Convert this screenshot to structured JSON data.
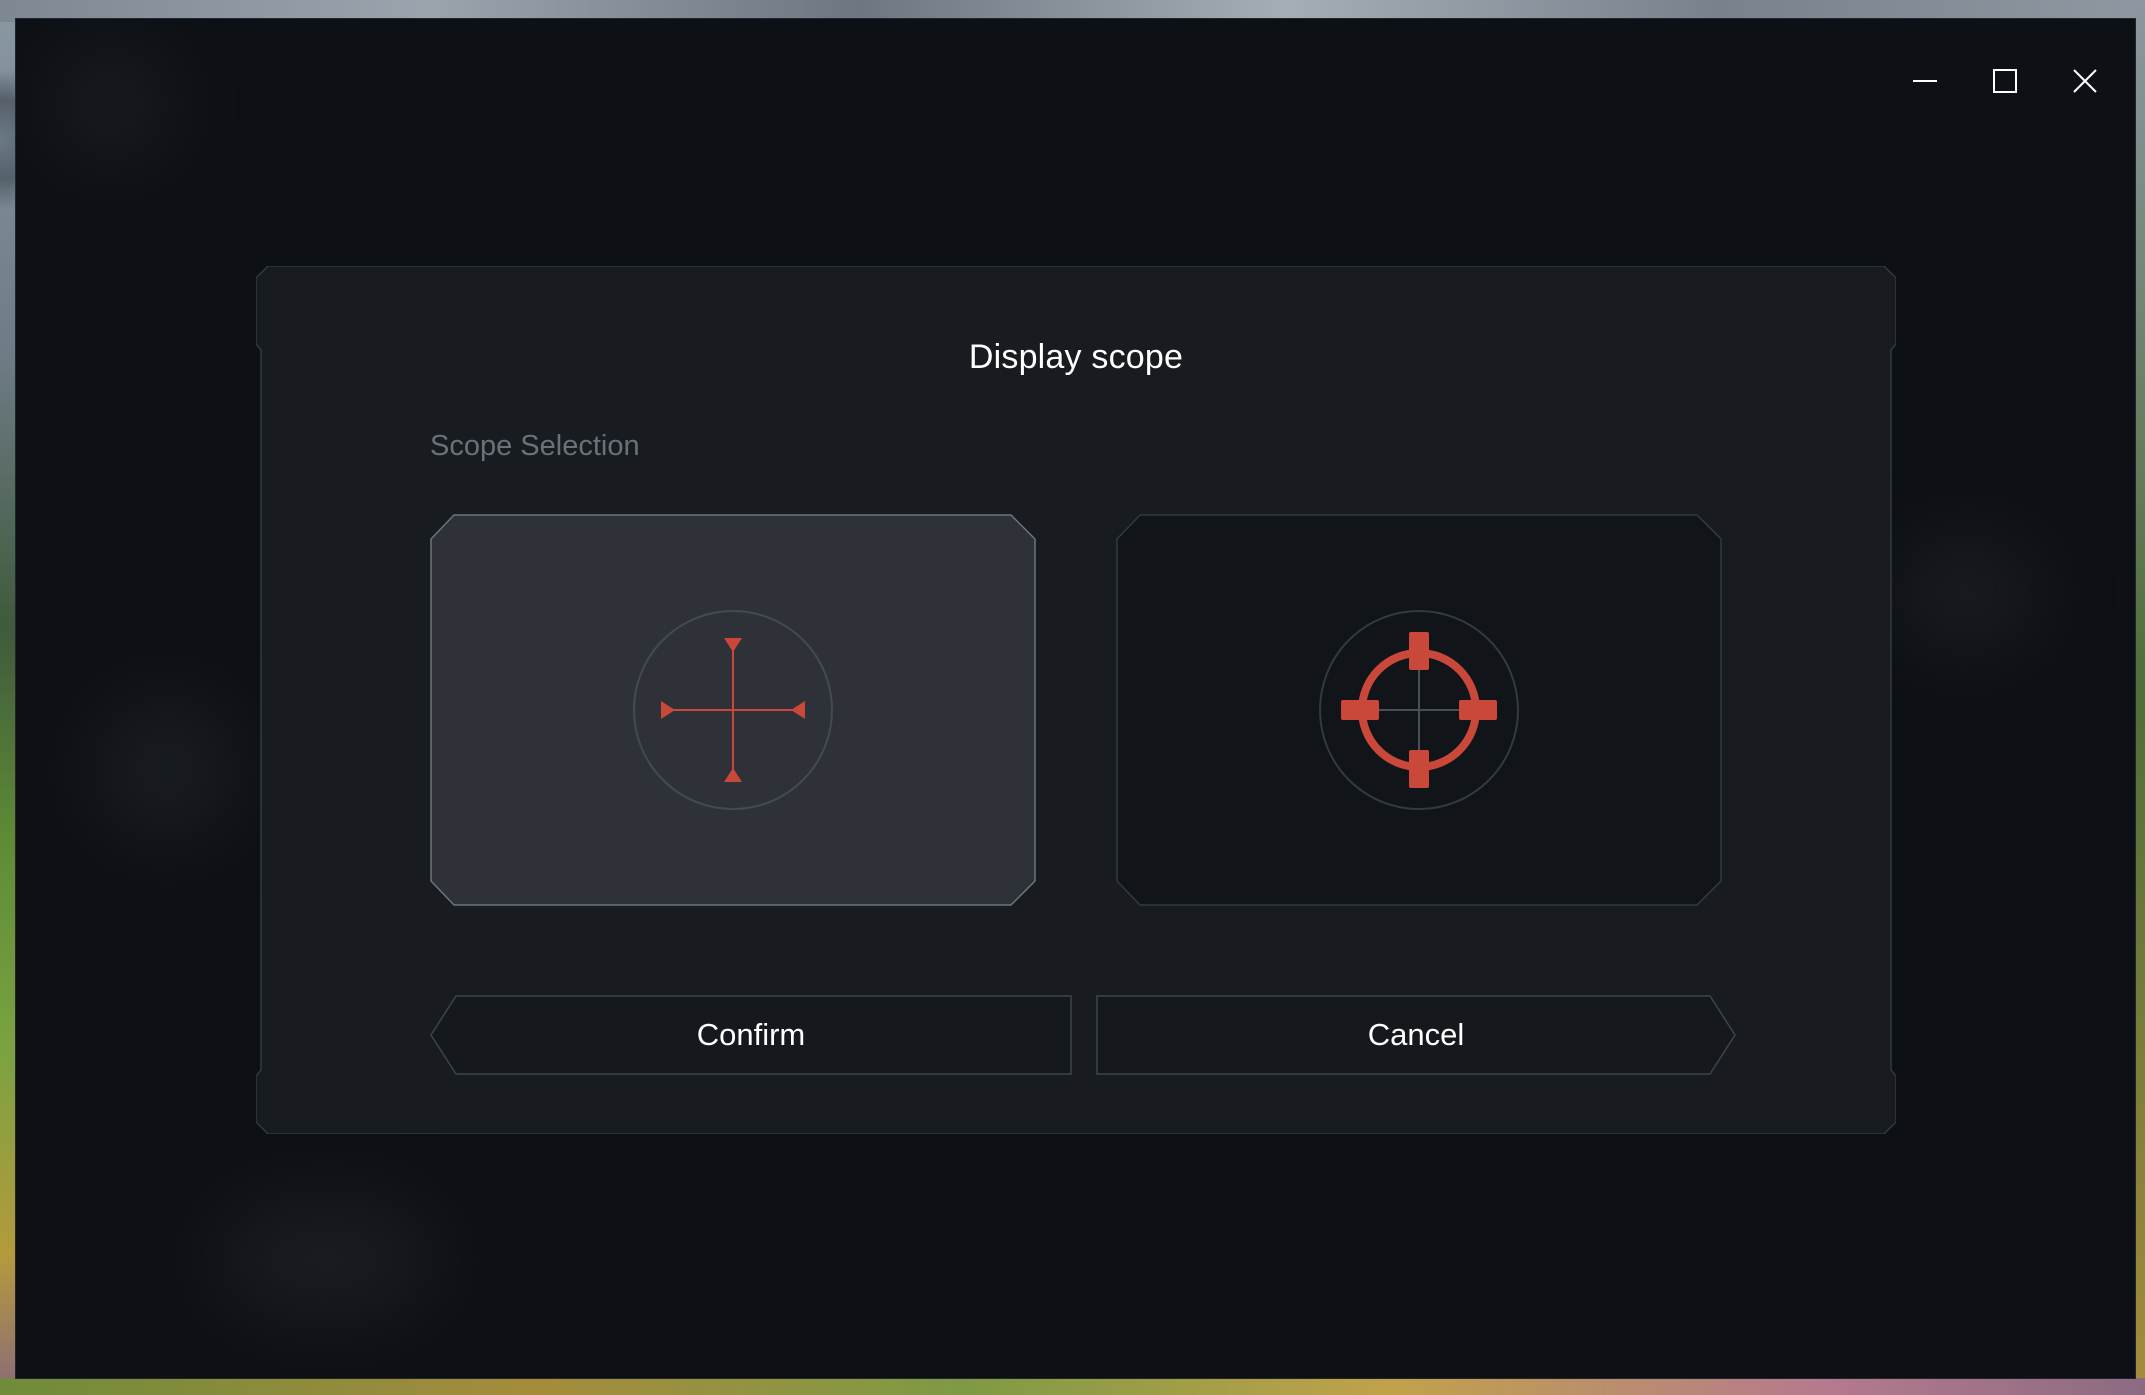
{
  "window": {
    "controls": {
      "minimize_icon": "minimize-icon",
      "maximize_icon": "maximize-icon",
      "close_icon": "close-icon"
    }
  },
  "dialog": {
    "title": "Display scope",
    "section_label": "Scope Selection",
    "options": [
      {
        "icon": "crosshair-arrows-icon",
        "selected": true
      },
      {
        "icon": "crosshair-target-icon",
        "selected": false
      }
    ],
    "buttons": {
      "confirm": "Confirm",
      "cancel": "Cancel"
    }
  },
  "colors": {
    "window_bg": "#0d1014",
    "dialog_bg": "#181b20",
    "dialog_border": "#343942",
    "option_selected_bg": "#2e3238",
    "option_bg": "#111418",
    "accent_red": "#c9483a",
    "text_primary": "#ffffff",
    "text_muted": "#6b7179"
  }
}
